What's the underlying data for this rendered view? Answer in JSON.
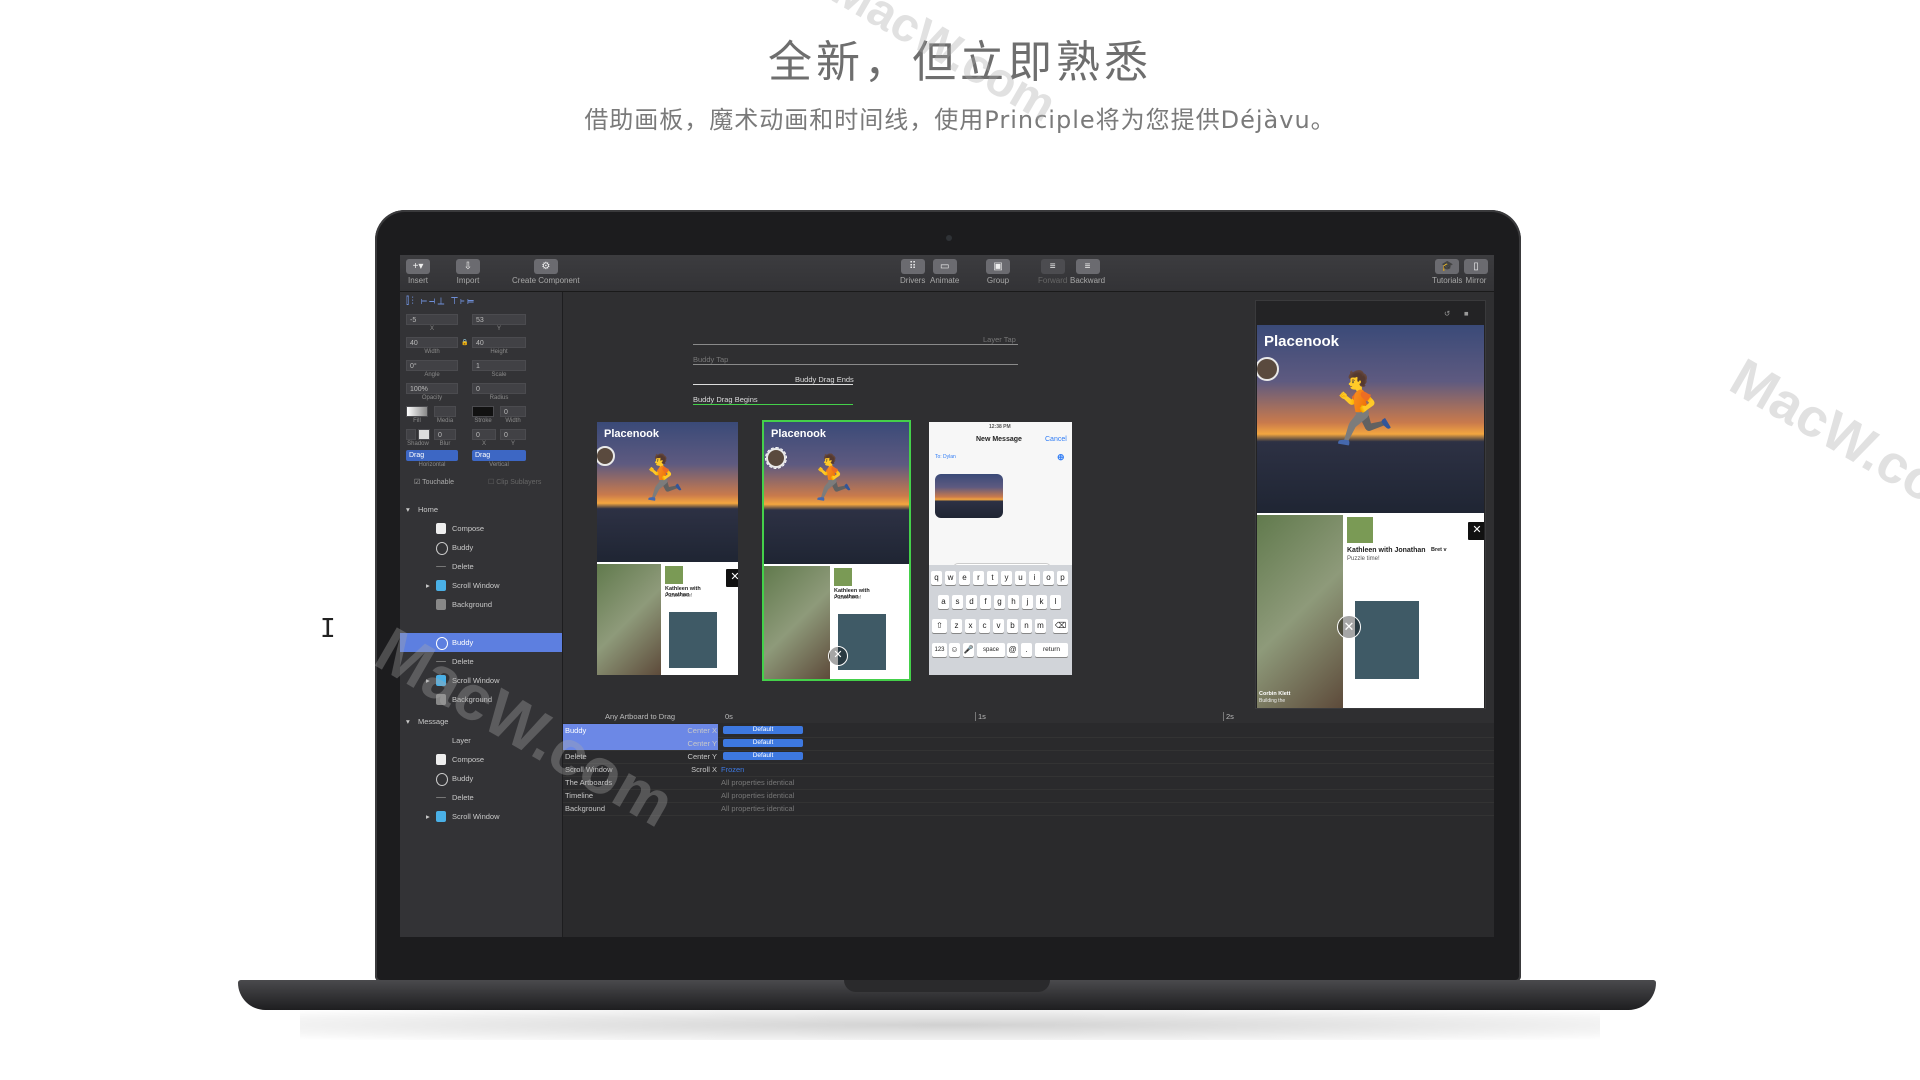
{
  "headline": "全新，但立即熟悉",
  "subheadline": "借助画板，魔术动画和时间线，使用Principle将为您提供Déjàvu。",
  "watermark": "MacW.com",
  "watermark_small": "MacW.co",
  "toolbar": {
    "insert": "Insert",
    "import": "Import",
    "create_component": "Create Component",
    "drivers": "Drivers",
    "animate": "Animate",
    "group": "Group",
    "forward": "Forward",
    "backward": "Backward",
    "tutorials": "Tutorials",
    "mirror": "Mirror"
  },
  "inspector": {
    "x_value": "-5",
    "x_label": "X",
    "y_value": "53",
    "y_label": "Y",
    "width_value": "40",
    "width_label": "Width",
    "height_value": "40",
    "height_label": "Height",
    "angle_value": "0°",
    "angle_label": "Angle",
    "scale_value": "1",
    "scale_label": "Scale",
    "opacity_value": "100%",
    "opacity_label": "Opacity",
    "radius_value": "0",
    "radius_label": "Radius",
    "fill_label": "Fill",
    "media_label": "Media",
    "stroke_label": "Stroke",
    "stroke_width_value": "0",
    "width2_label": "Width",
    "shadow_label": "Shadow",
    "blur_value": "0",
    "blur_label": "Blur",
    "sx_value": "0",
    "sx_label": "X",
    "sy_value": "0",
    "sy_label": "Y",
    "horizontal_value": "Drag",
    "horizontal_label": "Horizontal",
    "vertical_value": "Drag",
    "vertical_label": "Vertical",
    "touchable": "Touchable",
    "clip_sublayers": "Clip Sublayers"
  },
  "layers": {
    "home": "Home",
    "home_items": [
      "Compose",
      "Buddy",
      "Delete",
      "Scroll Window",
      "Background",
      "Buddy",
      "Delete",
      "Scroll Window",
      "Background"
    ],
    "message": "Message",
    "message_items": [
      "Layer",
      "Compose",
      "Buddy",
      "Delete",
      "Scroll Window"
    ]
  },
  "canvas": {
    "layer_tap": "Layer Tap",
    "buddy_tap": "Buddy Tap",
    "buddy_drag_ends": "Buddy Drag Ends",
    "buddy_drag_begins": "Buddy Drag Begins",
    "artboard_title": "Placenook",
    "card_title": "Kathleen with Jonathan",
    "card_sub": "Puzzle time!",
    "card_person": "Corbin Klett",
    "card_person_sub": "Building the",
    "card_cut": "Bret v",
    "time": "12:38 PM",
    "new_message": "New Message",
    "cancel": "Cancel",
    "to": "To: Dylan",
    "keys_row1": [
      "q",
      "w",
      "e",
      "r",
      "t",
      "y",
      "u",
      "i",
      "o",
      "p"
    ],
    "keys_row2": [
      "a",
      "s",
      "d",
      "f",
      "g",
      "h",
      "j",
      "k",
      "l"
    ],
    "keys_row3": [
      "z",
      "x",
      "c",
      "v",
      "b",
      "n",
      "m"
    ],
    "key_123": "123",
    "key_space": "space",
    "key_at": "@",
    "key_dot": ".",
    "key_return": "return"
  },
  "timeline": {
    "driver": "Any Artboard to Drag",
    "ticks": [
      "0s",
      "1s",
      "2s"
    ],
    "rows": [
      {
        "name": "Buddy",
        "prop": "Center X",
        "value": "Default"
      },
      {
        "name": "",
        "prop": "Center Y",
        "value": "Default"
      },
      {
        "name": "Delete",
        "prop": "Center Y",
        "value": "Default"
      },
      {
        "name": "Scroll Window",
        "prop": "Scroll X",
        "value": "Frozen"
      },
      {
        "name": "The Artboards",
        "prop": "",
        "value": "All properties identical"
      },
      {
        "name": "Timeline",
        "prop": "",
        "value": "All properties identical"
      },
      {
        "name": "Background",
        "prop": "",
        "value": "All properties identical"
      }
    ]
  },
  "colors": {
    "accent": "#3d78e0",
    "selection": "#5d7fe0",
    "artboard_active": "#44d04a"
  }
}
